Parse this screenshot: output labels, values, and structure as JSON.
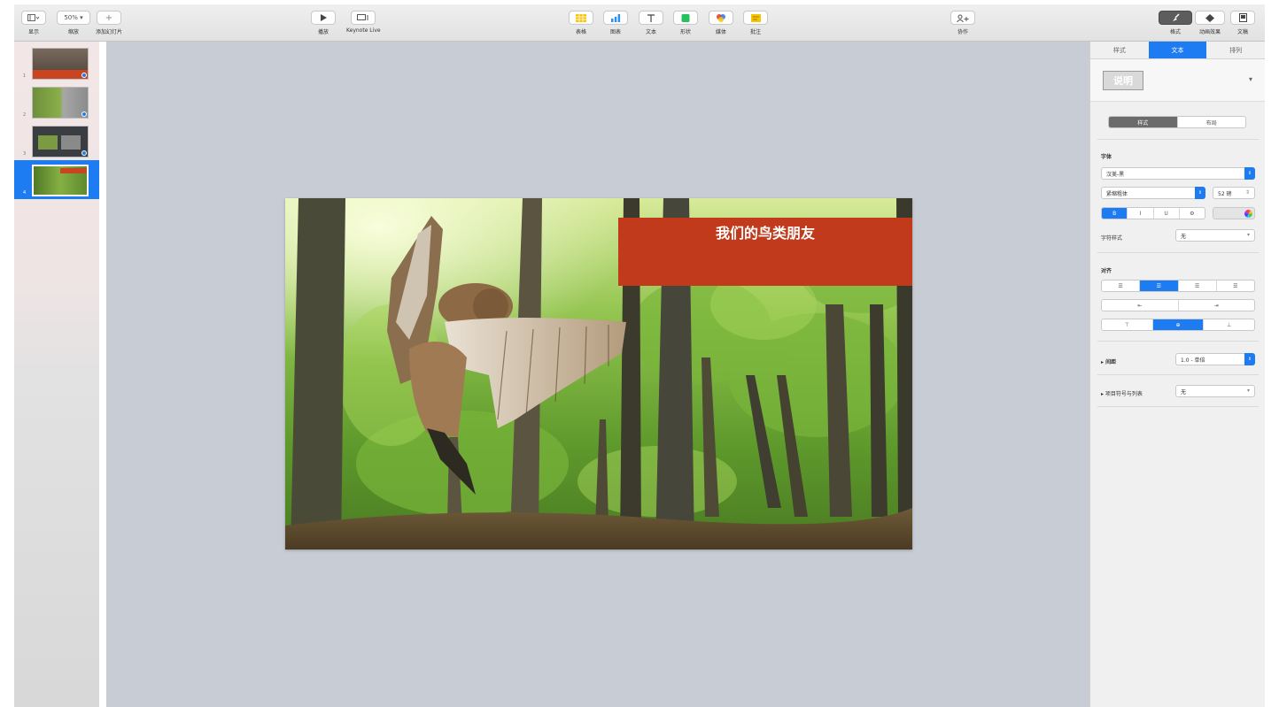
{
  "toolbar": {
    "view": {
      "label": "显示"
    },
    "zoom": {
      "value": "50%",
      "label": "缩放"
    },
    "add_slide": {
      "label": "添加幻灯片"
    },
    "play": {
      "label": "播放"
    },
    "keynote_live": {
      "label": "Keynote Live"
    },
    "table": {
      "label": "表格"
    },
    "chart": {
      "label": "图表"
    },
    "text": {
      "label": "文本"
    },
    "shape": {
      "label": "形状"
    },
    "media": {
      "label": "媒体"
    },
    "comment": {
      "label": "批注"
    },
    "collaborate": {
      "label": "协作"
    },
    "format": {
      "label": "格式"
    },
    "animate": {
      "label": "动画效果"
    },
    "document": {
      "label": "文稿"
    }
  },
  "navigator": {
    "slides": [
      {
        "num": "1"
      },
      {
        "num": "2"
      },
      {
        "num": "3"
      },
      {
        "num": "4",
        "selected": true
      }
    ]
  },
  "slide": {
    "title": "我们的鸟类朋友"
  },
  "inspector": {
    "tabs": [
      "样式",
      "文本",
      "排列"
    ],
    "active_tab": "文本",
    "paragraph_style": "说明",
    "style_layout_tabs": [
      "样式",
      "布局"
    ],
    "font_section": "字体",
    "font_family": "汉美-黑",
    "font_weight": "紧缩粗体",
    "font_size": "52 磅",
    "font_styles": [
      "B",
      "I",
      "U",
      "⚙"
    ],
    "char_style_label": "字符样式",
    "char_style_value": "无",
    "align_section": "对齐",
    "align_buttons": [
      "☰",
      "☰",
      "☰",
      "☰"
    ],
    "indent_buttons": [
      "⇤",
      "⇥"
    ],
    "valign_buttons": [
      "⊤",
      "⊕",
      "⊥"
    ],
    "spacing_label": "间距",
    "spacing_value": "1.0 - 单倍",
    "bullets_label": "项目符号与列表",
    "bullets_value": "无"
  },
  "colors": {
    "accent": "#1d7cf2",
    "title_box": "#c23a1c",
    "canvas_bg": "#c8ccd4"
  }
}
